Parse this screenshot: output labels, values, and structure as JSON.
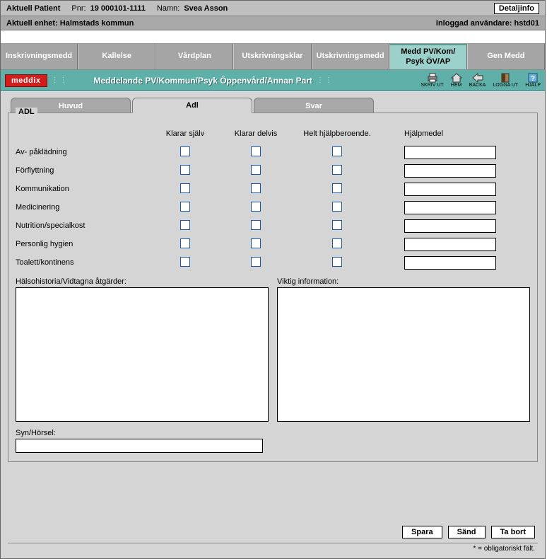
{
  "header": {
    "patient_label": "Aktuell Patient",
    "pnr_label": "Pnr:",
    "pnr_value": "19 000101-1111",
    "name_label": "Namn:",
    "name_value": "Svea Asson",
    "detail_button": "Detaljinfo",
    "unit_label": "Aktuell enhet: Halmstads kommun",
    "user_label": "Inloggad användare: hstd01"
  },
  "main_tabs": [
    "Inskrivningsmedd",
    "Kallelse",
    "Vårdplan",
    "Utskrivningsklar",
    "Utskrivningsmedd",
    "Medd PV/Kom/\nPsyk ÖV/AP",
    "Gen Medd"
  ],
  "teal": {
    "logo": "meddix",
    "title": "Meddelande PV/Kommun/Psyk Öppenvård/Annan Part",
    "tools": {
      "print": "SKRIV UT",
      "home": "HEM",
      "back": "BACKA",
      "logout": "LOGGA UT",
      "help": "HJÄLP"
    }
  },
  "sub_tabs": [
    "Huvud",
    "Adl",
    "Svar"
  ],
  "adl": {
    "legend": "ADL",
    "columns": [
      "Klarar själv",
      "Klarar delvis",
      "Helt hjälpberoende.",
      "Hjälpmedel"
    ],
    "rows": [
      {
        "label": "Av- påklädning",
        "aid": ""
      },
      {
        "label": "Förflyttning",
        "aid": ""
      },
      {
        "label": "Kommunikation",
        "aid": ""
      },
      {
        "label": "Medicinering",
        "aid": ""
      },
      {
        "label": "Nutrition/specialkost",
        "aid": ""
      },
      {
        "label": "Personlig hygien",
        "aid": ""
      },
      {
        "label": "Toalett/kontinens",
        "aid": ""
      }
    ],
    "history_label": "Hälsohistoria/Vidtagna åtgärder:",
    "history_value": "",
    "info_label": "Viktig information:",
    "info_value": "",
    "syn_label": "Syn/Hörsel:",
    "syn_value": ""
  },
  "buttons": {
    "save": "Spara",
    "send": "Sänd",
    "delete": "Ta bort"
  },
  "footnote": "* = obligatoriskt fält."
}
